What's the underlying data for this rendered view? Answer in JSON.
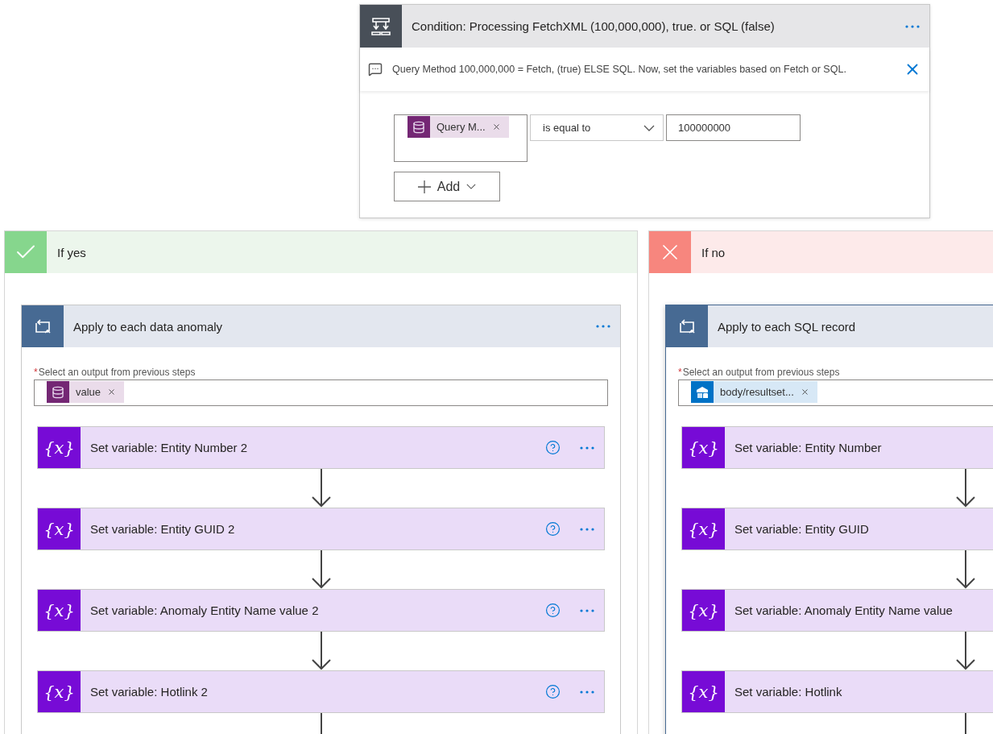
{
  "condition": {
    "title": "Condition: Processing FetchXML (100,000,000), true. or SQL (false)",
    "comment": "Query Method 100,000,000 = Fetch, (true) ELSE SQL. Now, set the variables based on Fetch or SQL.",
    "operand": {
      "text": "Query M...",
      "kind": "dataverse"
    },
    "operator": "is equal to",
    "value": "100000000",
    "add_button": "Add"
  },
  "branches": [
    {
      "kind": "yes",
      "title": "If yes",
      "loop": {
        "title": "Apply to each data anomaly",
        "selected": false,
        "menu": true,
        "required_mark": "*",
        "output_label": "Select an output from previous steps",
        "token": {
          "text": "value",
          "kind": "dataverse"
        },
        "continues": true,
        "steps": [
          {
            "icon": "{x}",
            "title": "Set variable: Entity Number 2",
            "actions": true
          },
          {
            "icon": "{x}",
            "title": "Set variable: Entity GUID 2",
            "actions": true
          },
          {
            "icon": "{x}",
            "title": "Set variable: Anomaly Entity Name value 2",
            "actions": true
          },
          {
            "icon": "{x}",
            "title": "Set variable: Hotlink 2",
            "actions": true
          }
        ]
      }
    },
    {
      "kind": "no",
      "title": "If no",
      "loop": {
        "title": "Apply to each SQL record",
        "selected": true,
        "menu": false,
        "required_mark": "*",
        "output_label": "Select an output from previous steps",
        "token": {
          "text": "body/resultset...",
          "kind": "sql"
        },
        "continues": true,
        "steps": [
          {
            "icon": "{x}",
            "title": "Set variable: Entity Number"
          },
          {
            "icon": "{x}",
            "title": "Set variable: Entity GUID"
          },
          {
            "icon": "{x}",
            "title": "Set variable: Anomaly Entity Name value"
          },
          {
            "icon": "{x}",
            "title": "Set variable: Hotlink"
          }
        ]
      }
    }
  ]
}
